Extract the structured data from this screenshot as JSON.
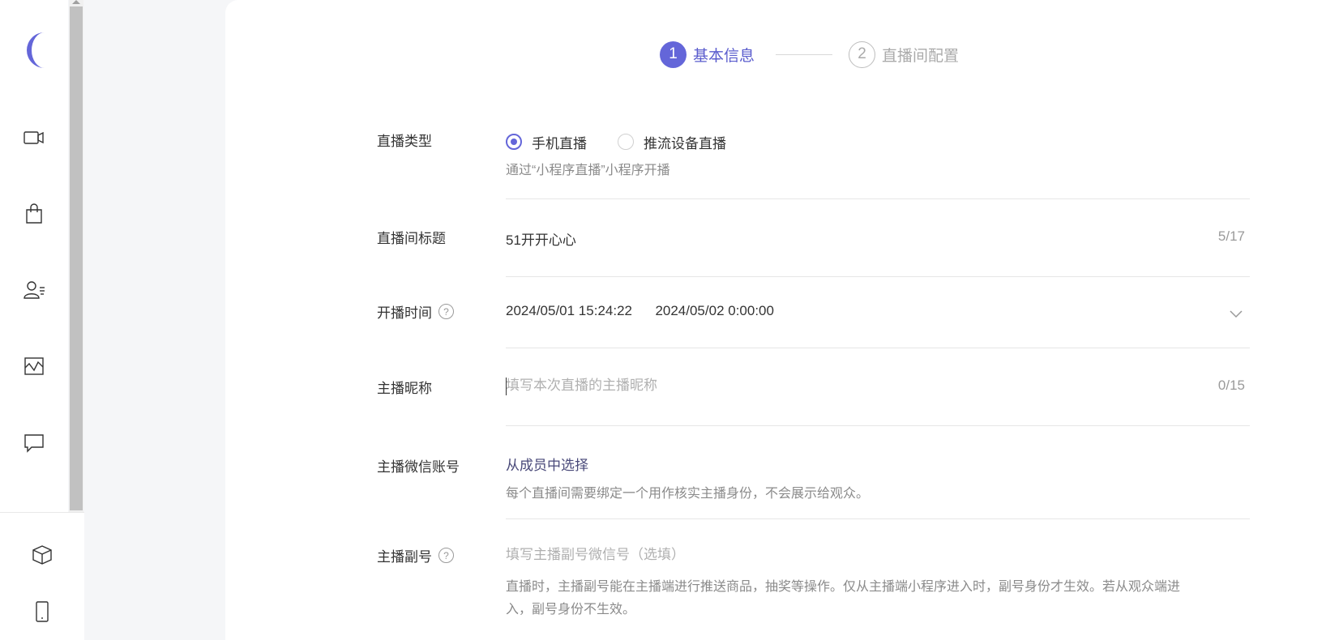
{
  "steps": [
    {
      "number": "1",
      "label": "基本信息"
    },
    {
      "number": "2",
      "label": "直播间配置"
    }
  ],
  "form": {
    "live_type": {
      "label": "直播类型",
      "options": [
        "手机直播",
        "推流设备直播"
      ],
      "selected": "手机直播",
      "hint": "通过“小程序直播”小程序开播"
    },
    "title": {
      "label": "直播间标题",
      "value": "51开开心心",
      "counter": "5/17"
    },
    "time": {
      "label": "开播时间",
      "start": "2024/05/01 15:24:22",
      "end": "2024/05/02 0:00:00"
    },
    "nickname": {
      "label": "主播昵称",
      "placeholder": "填写本次直播的主播昵称",
      "counter": "0/15"
    },
    "wechat": {
      "label": "主播微信账号",
      "link": "从成员中选择",
      "hint": "每个直播间需要绑定一个用作核实主播身份，不会展示给观众。"
    },
    "sub_account": {
      "label": "主播副号",
      "placeholder": "填写主播副号微信号（选填）",
      "hint_line1": "直播时，主播副号能在主播端进行推送商品，抽奖等操作。仅从主播端小程序进入时，副号身份才生效。若从观众端进",
      "hint_line2": "入，副号身份不生效。"
    }
  },
  "help_glyph": "?",
  "colors": {
    "accent": "#6466d9"
  }
}
